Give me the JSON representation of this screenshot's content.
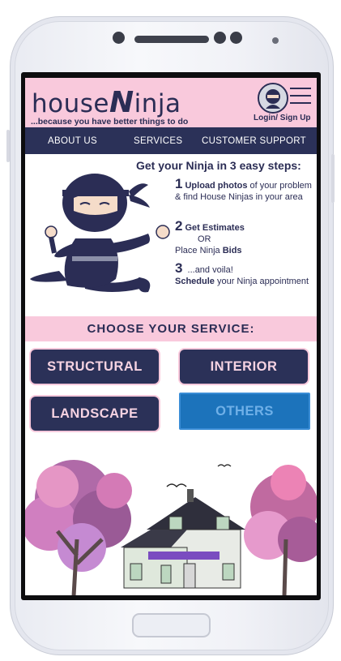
{
  "header": {
    "logo_left": "house",
    "logo_n": "N",
    "logo_right": "inja",
    "tagline": "...because you have better things to do",
    "login_label": "Login/ Sign Up"
  },
  "nav": {
    "items": [
      "ABOUT US",
      "SERVICES",
      "CUSTOMER SUPPORT"
    ]
  },
  "steps": {
    "title": "Get your Ninja in 3 easy steps:",
    "step1": {
      "num": "1",
      "bold": "Upload photos",
      "rest": " of your problem & find House Ninjas in your area"
    },
    "step2": {
      "num": "2",
      "bold": "Get Estimates",
      "or": "OR",
      "prefix": "Place Ninja ",
      "bold2": "Bids"
    },
    "step3": {
      "num": "3",
      "text": " ...and voila!",
      "bold": "Schedule",
      "rest": " your Ninja appointment"
    }
  },
  "services": {
    "heading": "CHOOSE YOUR SERVICE:",
    "buttons": [
      "STRUCTURAL",
      "INTERIOR",
      "LANDSCAPE",
      "OTHERS"
    ]
  },
  "colors": {
    "pink": "#f9c9dc",
    "navy": "#2b3158",
    "blue_selected": "#1c73bb"
  }
}
